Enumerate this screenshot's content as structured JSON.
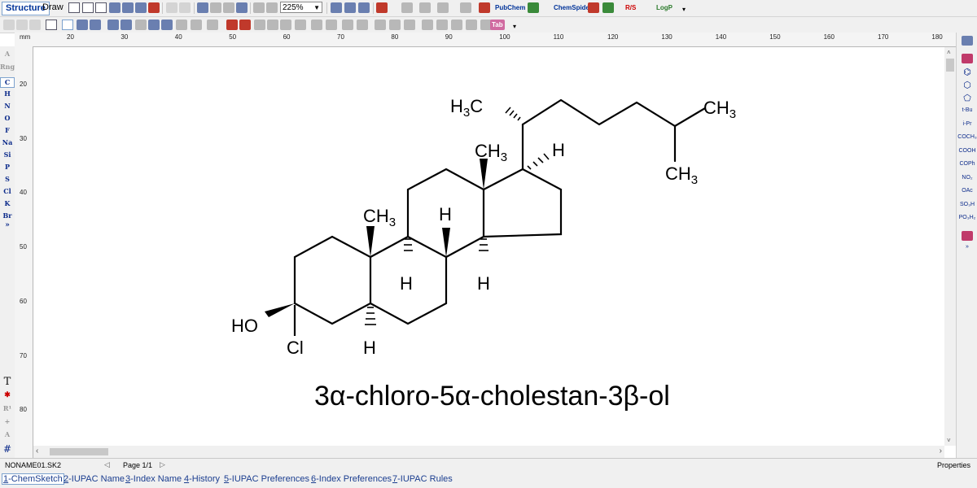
{
  "toolbar": {
    "mode_structure": "Structure",
    "mode_draw": "Draw",
    "zoom": "225%",
    "pubchem_label": "PubChem",
    "chemspider_label": "ChemSpider",
    "rs_label": "R/S",
    "logp_label": "LogP",
    "calc_label": "Tab"
  },
  "ruler": {
    "unit": "mm",
    "h_ticks": [
      "20",
      "30",
      "40",
      "50",
      "60",
      "70",
      "80",
      "90",
      "100",
      "110",
      "120",
      "130",
      "140",
      "150",
      "160",
      "170",
      "180"
    ],
    "v_ticks": [
      "20",
      "30",
      "40",
      "50",
      "60",
      "70",
      "80"
    ]
  },
  "left_panel": {
    "elements": [
      "C",
      "H",
      "N",
      "O",
      "F",
      "Na",
      "Si",
      "P",
      "S",
      "Cl",
      "K",
      "Br"
    ],
    "more": "»",
    "bottom_tools": [
      "T",
      "R¹",
      "#"
    ]
  },
  "right_panel": {
    "groups": [
      "t-Bu",
      "i-Pr",
      "COCH₃",
      "COOH",
      "COPh",
      "NO₂",
      "OAc",
      "SO₃H",
      "PO₃H₂"
    ]
  },
  "molecule": {
    "label_h3c": "H",
    "label_h3c_sub": "3",
    "label_h3c_c": "C",
    "label_ch3": "CH",
    "label_ch3_sub": "3",
    "label_h": "H",
    "label_ho": "HO",
    "label_cl": "Cl",
    "name": "3α-chloro-5α-cholestan-3β-ol"
  },
  "status": {
    "filename": "NONAME01.SK2",
    "page": "Page 1/1",
    "properties": "Properties"
  },
  "tabs": [
    {
      "num": "1",
      "label": "-ChemSketch"
    },
    {
      "num": "2",
      "label": "-IUPAC Name"
    },
    {
      "num": "3",
      "label": "-Index Name"
    },
    {
      "num": "4",
      "label": "-History"
    },
    {
      "num": "5",
      "label": "-IUPAC Preferences"
    },
    {
      "num": "6",
      "label": "-Index Preferences"
    },
    {
      "num": "7",
      "label": "-IUPAC Rules"
    }
  ]
}
